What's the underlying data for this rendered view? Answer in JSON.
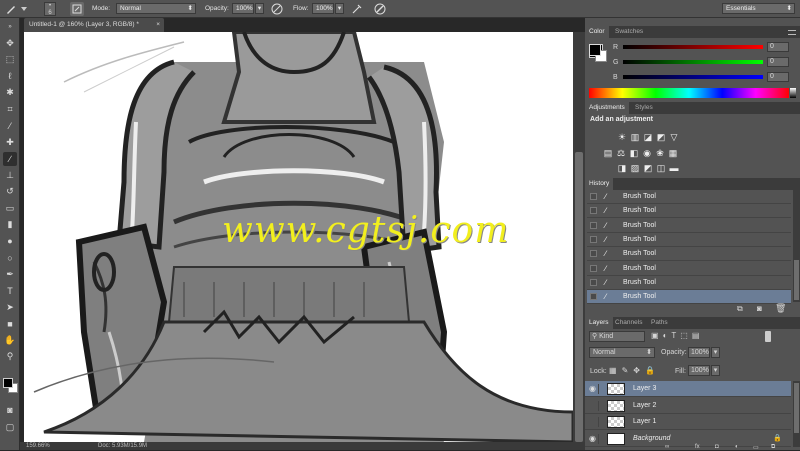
{
  "options_bar": {
    "brush_size": "6",
    "mode_label": "Mode:",
    "mode_value": "Normal",
    "opacity_label": "Opacity:",
    "opacity_value": "100%",
    "flow_label": "Flow:",
    "flow_value": "100%",
    "workspace": "Essentials"
  },
  "document": {
    "tab_title": "Untitled-1 @ 160% (Layer 3, RGB/8) *",
    "zoom": "159.66%",
    "doc_info": "Doc: 5.93M/15.9M",
    "watermark": "www.cgtsj.com"
  },
  "color_panel": {
    "tabs": [
      "Color",
      "Swatches"
    ],
    "channels": [
      {
        "label": "R",
        "value": "0",
        "color": "#d02020"
      },
      {
        "label": "G",
        "value": "0",
        "color": "#20b030"
      },
      {
        "label": "B",
        "value": "0",
        "color": "#2030d0"
      }
    ]
  },
  "adjustments_panel": {
    "tabs": [
      "Adjustments",
      "Styles"
    ],
    "title": "Add an adjustment"
  },
  "history_panel": {
    "tab": "History",
    "items": [
      "Brush Tool",
      "Brush Tool",
      "Brush Tool",
      "Brush Tool",
      "Brush Tool",
      "Brush Tool",
      "Brush Tool",
      "Brush Tool"
    ],
    "selected_index": 7
  },
  "layers_panel": {
    "tabs": [
      "Layers",
      "Channels",
      "Paths"
    ],
    "filter_kind": "Kind",
    "blend_mode": "Normal",
    "opacity_label": "Opacity:",
    "opacity_value": "100%",
    "lock_label": "Lock:",
    "fill_label": "Fill:",
    "fill_value": "100%",
    "layers": [
      {
        "name": "Layer 3",
        "selected": true,
        "visible": true
      },
      {
        "name": "Layer 2",
        "selected": false,
        "visible": false
      },
      {
        "name": "Layer 1",
        "selected": false,
        "visible": false
      },
      {
        "name": "Background",
        "selected": false,
        "visible": true
      }
    ]
  },
  "tools": [
    "move-tool",
    "marquee-tool",
    "lasso-tool",
    "quick-select-tool",
    "crop-tool",
    "eyedropper-tool",
    "healing-tool",
    "brush-tool",
    "stamp-tool",
    "history-brush-tool",
    "eraser-tool",
    "gradient-tool",
    "blur-tool",
    "dodge-tool",
    "pen-tool",
    "type-tool",
    "path-select-tool",
    "shape-tool",
    "hand-tool",
    "zoom-tool"
  ],
  "colors": {
    "accent_selected": "#6b7d96",
    "watermark": "#f2ef1e"
  }
}
